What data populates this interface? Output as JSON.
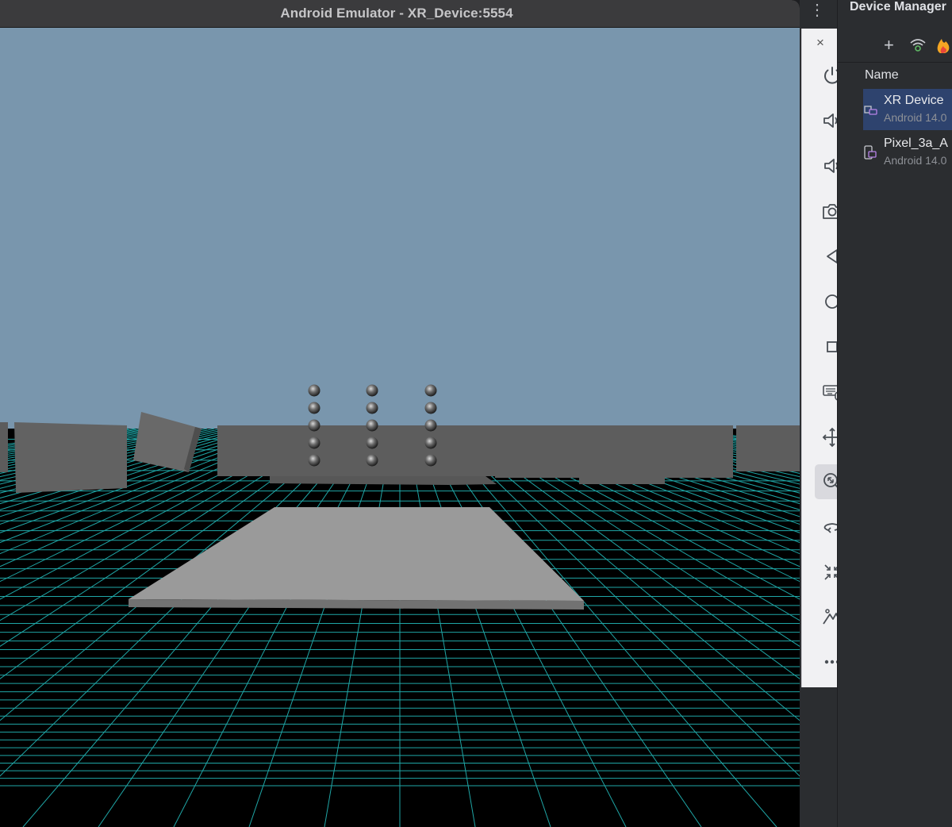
{
  "emulator": {
    "title": "Android Emulator - XR_Device:5554"
  },
  "toolbar": {
    "window_controls": {
      "close": "×",
      "minimize": "−"
    },
    "buttons": [
      {
        "name": "power-icon",
        "label": "Power"
      },
      {
        "name": "volume-up-icon",
        "label": "Volume up"
      },
      {
        "name": "volume-down-icon",
        "label": "Volume down"
      },
      {
        "name": "camera-icon",
        "label": "Take screenshot"
      },
      {
        "name": "back-icon",
        "label": "Back"
      },
      {
        "name": "home-icon",
        "label": "Home"
      },
      {
        "name": "overview-icon",
        "label": "Overview"
      },
      {
        "name": "keyboard-mouse-icon",
        "label": "Keyboard and mouse"
      },
      {
        "name": "move-icon",
        "label": "Move"
      },
      {
        "name": "zoom-icon",
        "label": "Zoom",
        "active": true
      },
      {
        "name": "rotate-icon",
        "label": "Rotate"
      },
      {
        "name": "reset-view-icon",
        "label": "Reset view"
      },
      {
        "name": "environment-icon",
        "label": "Environment"
      },
      {
        "name": "more-icon",
        "label": "More"
      }
    ]
  },
  "device_manager": {
    "title": "Device Manager",
    "toolbar_icons": [
      "add-icon",
      "wifi-pairing-icon",
      "firebase-icon"
    ],
    "add_label": "+",
    "column_header": "Name",
    "devices": [
      {
        "name": "XR Device",
        "subtitle": "Android 14.0",
        "selected": true
      },
      {
        "name": "Pixel_3a_A",
        "subtitle": "Android 14.0",
        "selected": false
      }
    ]
  },
  "colors": {
    "sky": "#7996ad",
    "grid_line": "#1fa6a6",
    "selected_row": "#2e436e",
    "toolbar_bg": "#f1f1f3"
  }
}
